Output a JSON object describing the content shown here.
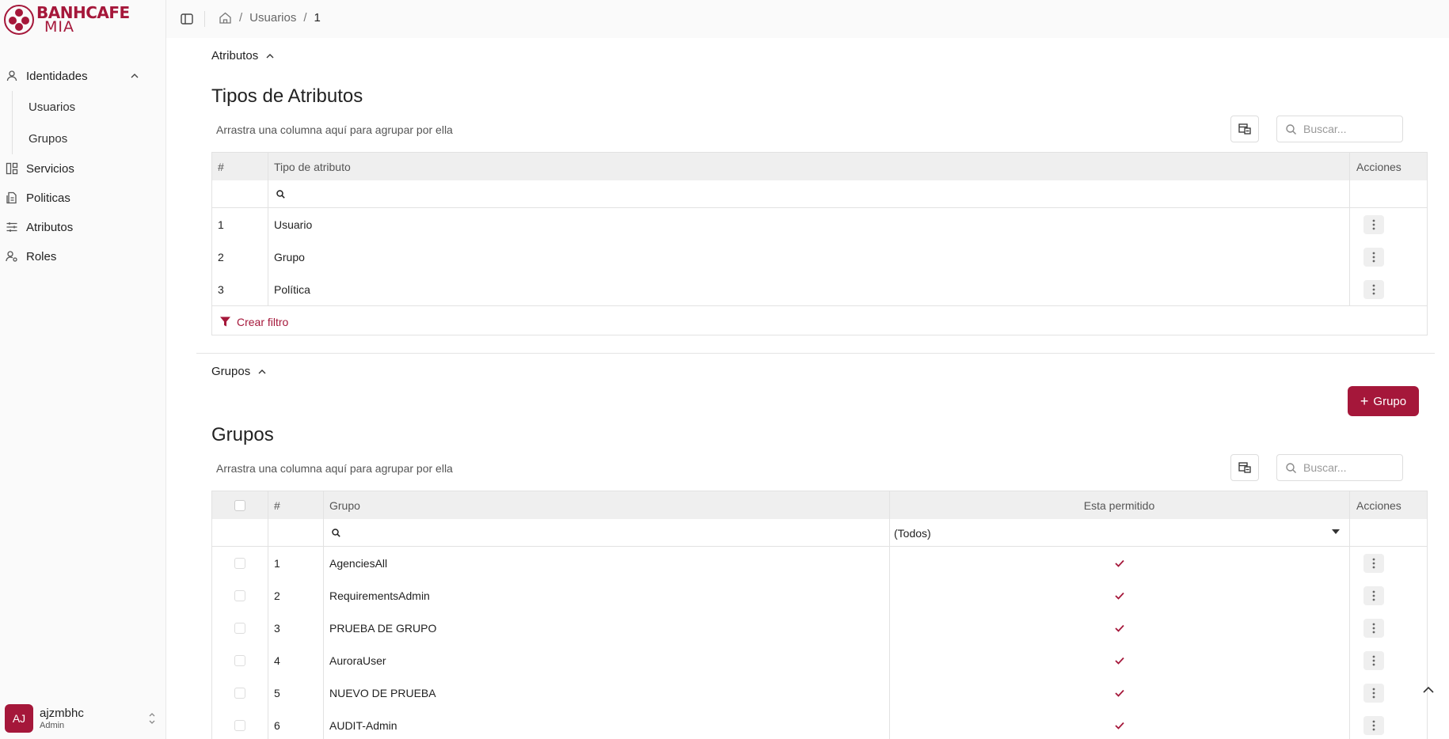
{
  "brand": {
    "line1": "BANHCAFE",
    "line2": "MIA",
    "color": "#a5173a"
  },
  "sidebar": {
    "items": [
      {
        "label": "Identidades",
        "icon": "user-icon",
        "expanded": true,
        "children": [
          {
            "label": "Usuarios"
          },
          {
            "label": "Grupos"
          }
        ]
      },
      {
        "label": "Servicios",
        "icon": "layout-icon"
      },
      {
        "label": "Politicas",
        "icon": "policy-icon"
      },
      {
        "label": "Atributos",
        "icon": "sliders-icon"
      },
      {
        "label": "Roles",
        "icon": "user-cog-icon"
      }
    ],
    "user": {
      "initials": "AJ",
      "name": "ajzmbhc",
      "role": "Admin"
    }
  },
  "breadcrumb": {
    "items": [
      "Usuarios",
      "1"
    ]
  },
  "atributos": {
    "toggle_label": "Atributos",
    "title": "Tipos de Atributos",
    "group_hint": "Arrastra una columna aquí para agrupar por ella",
    "search_placeholder": "Buscar...",
    "columns": {
      "num": "#",
      "type": "Tipo de atributo",
      "actions": "Acciones"
    },
    "rows": [
      {
        "num": "1",
        "type": "Usuario"
      },
      {
        "num": "2",
        "type": "Grupo"
      },
      {
        "num": "3",
        "type": "Política"
      }
    ],
    "footer_label": "Crear filtro"
  },
  "grupos": {
    "toggle_label": "Grupos",
    "add_button": "Grupo",
    "title": "Grupos",
    "group_hint": "Arrastra una columna aquí para agrupar por ella",
    "search_placeholder": "Buscar...",
    "columns": {
      "num": "#",
      "group": "Grupo",
      "allowed": "Esta permitido",
      "actions": "Acciones"
    },
    "allowed_filter": "(Todos)",
    "rows": [
      {
        "num": "1",
        "group": "AgenciesAll",
        "allowed": true
      },
      {
        "num": "2",
        "group": "RequirementsAdmin",
        "allowed": true
      },
      {
        "num": "3",
        "group": "PRUEBA DE GRUPO",
        "allowed": true
      },
      {
        "num": "4",
        "group": "AuroraUser",
        "allowed": true
      },
      {
        "num": "5",
        "group": "NUEVO DE PRUEBA",
        "allowed": true
      },
      {
        "num": "6",
        "group": "AUDIT-Admin",
        "allowed": true
      }
    ]
  }
}
